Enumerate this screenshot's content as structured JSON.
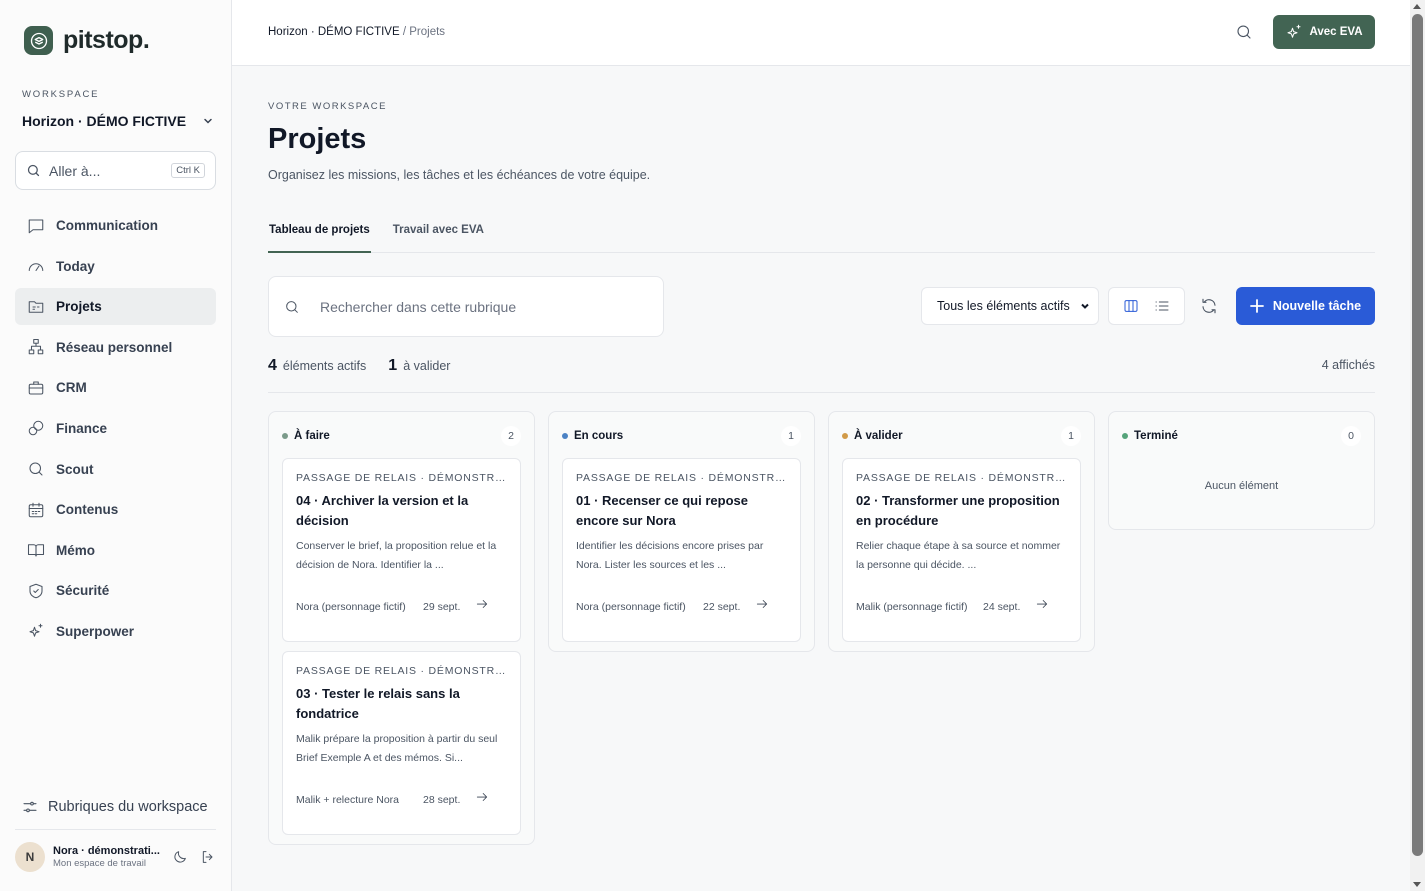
{
  "app": {
    "name": "pitstop."
  },
  "workspace": {
    "label": "WORKSPACE",
    "name": "Horizon · DÉMO FICTIVE"
  },
  "goto": {
    "placeholder": "Aller à...",
    "shortcut": "Ctrl K"
  },
  "nav": {
    "items": [
      {
        "label": "Communication",
        "icon": "chat-icon"
      },
      {
        "label": "Today",
        "icon": "gauge-icon"
      },
      {
        "label": "Projets",
        "icon": "folder-icon",
        "active": true
      },
      {
        "label": "Réseau personnel",
        "icon": "network-icon"
      },
      {
        "label": "CRM",
        "icon": "briefcase-icon"
      },
      {
        "label": "Finance",
        "icon": "coins-icon"
      },
      {
        "label": "Scout",
        "icon": "search-icon"
      },
      {
        "label": "Contenus",
        "icon": "calendar-icon"
      },
      {
        "label": "Mémo",
        "icon": "book-icon"
      },
      {
        "label": "Sécurité",
        "icon": "shield-icon"
      },
      {
        "label": "Superpower",
        "icon": "sparkles-icon"
      }
    ]
  },
  "footer": {
    "rubriques": "Rubriques du workspace",
    "user_initial": "N",
    "user_name": "Nora · démonstrati...",
    "user_sub": "Mon espace de travail"
  },
  "topbar": {
    "breadcrumb_ws": "Horizon · DÉMO FICTIVE",
    "breadcrumb_sep": "/",
    "breadcrumb_page": "Projets",
    "eva_button": "Avec EVA"
  },
  "page": {
    "eyebrow": "VOTRE WORKSPACE",
    "title": "Projets",
    "subtitle": "Organisez les missions, les tâches et les échéances de votre équipe."
  },
  "tabs": [
    {
      "label": "Tableau de projets",
      "active": true
    },
    {
      "label": "Travail avec EVA",
      "active": false
    }
  ],
  "toolbar": {
    "search_placeholder": "Rechercher dans cette rubrique",
    "filter": "Tous les éléments actifs",
    "new_task": "Nouvelle tâche"
  },
  "stats": {
    "active_count": "4",
    "active_label": "éléments actifs",
    "validate_count": "1",
    "validate_label": "à valider",
    "shown": "4 affichés"
  },
  "colors": {
    "accent_green": "#426453",
    "primary_blue": "#2a5bd7",
    "todo": "#7b9a8a",
    "in_progress": "#4b82c4",
    "to_validate": "#d19a48",
    "done": "#55a37a"
  },
  "columns": [
    {
      "title": "À faire",
      "count": "2",
      "cards": [
        {
          "kicker": "PASSAGE DE RELAIS · DÉMONSTRATI...",
          "title": "04 · Archiver la version et la décision",
          "desc": "Conserver le brief, la proposition relue et la décision de Nora. Identifier la ...",
          "owner": "Nora (personnage fictif)",
          "date": "29 sept."
        },
        {
          "kicker": "PASSAGE DE RELAIS · DÉMONSTRATI...",
          "title": "03 · Tester le relais sans la fondatrice",
          "desc": "Malik prépare la proposition à partir du seul Brief Exemple A et des mémos. Si...",
          "owner": "Malik + relecture Nora",
          "date": "28 sept."
        }
      ]
    },
    {
      "title": "En cours",
      "count": "1",
      "cards": [
        {
          "kicker": "PASSAGE DE RELAIS · DÉMONSTRATI...",
          "title": "01 · Recenser ce qui repose encore sur Nora",
          "desc": "Identifier les décisions encore prises par Nora. Lister les sources et les ...",
          "owner": "Nora (personnage fictif)",
          "date": "22 sept."
        }
      ]
    },
    {
      "title": "À valider",
      "count": "1",
      "cards": [
        {
          "kicker": "PASSAGE DE RELAIS · DÉMONSTRATI...",
          "title": "02 · Transformer une proposition en procédure",
          "desc": "Relier chaque étape à sa source et nommer la personne qui décide. ...",
          "owner": "Malik (personnage fictif)",
          "date": "24 sept."
        }
      ]
    },
    {
      "title": "Terminé",
      "count": "0",
      "empty": "Aucun élément",
      "cards": []
    }
  ]
}
